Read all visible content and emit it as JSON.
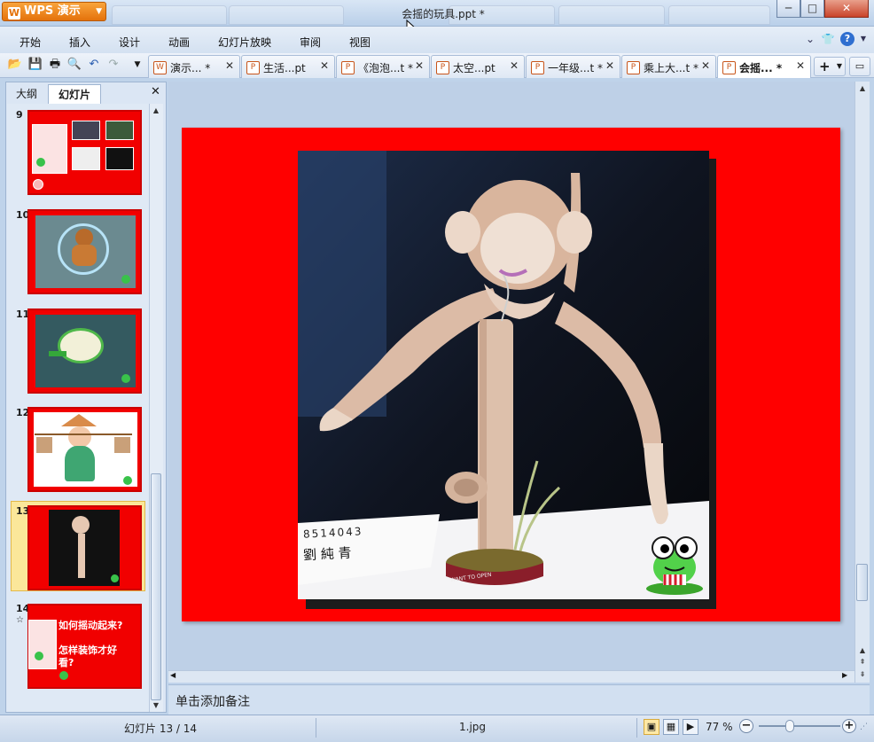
{
  "app": {
    "brand": "WPS 演示",
    "document_title": "会摇的玩具.ppt *"
  },
  "window_controls": {
    "minimize": "─",
    "maximize": "□",
    "close": "✕"
  },
  "menu": [
    "开始",
    "插入",
    "设计",
    "动画",
    "幻灯片放映",
    "审阅",
    "视图"
  ],
  "toolbar_icons": [
    "open-folder-icon",
    "save-icon",
    "print-icon",
    "print-preview-icon",
    "undo-icon",
    "redo-icon",
    "customize-icon"
  ],
  "doc_tabs": [
    {
      "label": "演示...",
      "mark": " *",
      "icon": "W"
    },
    {
      "label": "生活...pt",
      "mark": "",
      "icon": "P"
    },
    {
      "label": "《泡泡...t",
      "mark": " *",
      "icon": "P"
    },
    {
      "label": "太空...pt",
      "mark": "",
      "icon": "P"
    },
    {
      "label": "一年级...t",
      "mark": " *",
      "icon": "P"
    },
    {
      "label": "乘上大...t",
      "mark": " *",
      "icon": "P"
    },
    {
      "label": "会摇...",
      "mark": " *",
      "icon": "P",
      "active": true
    }
  ],
  "panel": {
    "tabs": [
      "大纲",
      "幻灯片"
    ],
    "active_tab": "幻灯片",
    "close": "✕",
    "thumbs": [
      {
        "num": "9"
      },
      {
        "num": "10"
      },
      {
        "num": "11"
      },
      {
        "num": "12"
      },
      {
        "num": "13",
        "selected": true
      },
      {
        "num": "14",
        "lines": [
          "如何摇动起来?",
          "怎样装饰才好",
          "看?"
        ]
      }
    ],
    "thumb9_caption": "▲"
  },
  "slide": {
    "photo_caption_line1": "8514043",
    "photo_caption_line2": "劉 純 青",
    "base_text": "WANT TO OPEN"
  },
  "notes": {
    "placeholder": "单击添加备注"
  },
  "status": {
    "slide_info": "幻灯片 13 / 14",
    "design": "1.jpg",
    "zoom": "77 %",
    "zoom_level": 0.38
  },
  "colors": {
    "slide_bg": "#ff0000",
    "accent_orange": "#e4720b"
  }
}
